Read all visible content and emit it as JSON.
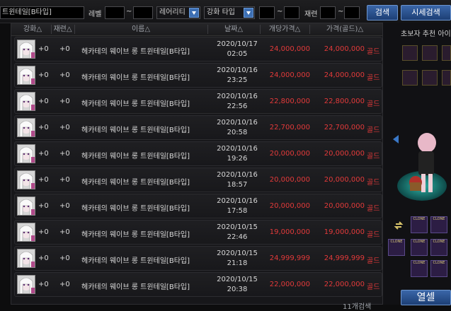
{
  "search": {
    "item_name": "트윈테일[B타입]",
    "level_label": "레벨",
    "range_sep": "~",
    "rarity_select": "레어리티",
    "reinforce_select": "강화 타입",
    "refine_label": "재련",
    "search_button": "검색",
    "market_price_button": "시세검색"
  },
  "columns": [
    "강화△",
    "재련△",
    "이름△",
    "날짜△",
    "개당가격△",
    "가격(골드)△"
  ],
  "rows": [
    {
      "reinforce": "+0",
      "refine": "+0",
      "name": "헤카테의 웨이브 롱 트윈테일[B타입]",
      "date": "2020/10/17",
      "time": "02:05",
      "unit_price": "24,000,000",
      "price": "24,000,000",
      "currency": "골드"
    },
    {
      "reinforce": "+0",
      "refine": "+0",
      "name": "헤카테의 웨이브 롱 트윈테일[B타입]",
      "date": "2020/10/16",
      "time": "23:25",
      "unit_price": "24,000,000",
      "price": "24,000,000",
      "currency": "골드"
    },
    {
      "reinforce": "+0",
      "refine": "+0",
      "name": "헤카테의 웨이브 롱 트윈테일[B타입]",
      "date": "2020/10/16",
      "time": "22:56",
      "unit_price": "22,800,000",
      "price": "22,800,000",
      "currency": "골드"
    },
    {
      "reinforce": "+0",
      "refine": "+0",
      "name": "헤카테의 웨이브 롱 트윈테일[B타입]",
      "date": "2020/10/16",
      "time": "20:58",
      "unit_price": "22,700,000",
      "price": "22,700,000",
      "currency": "골드"
    },
    {
      "reinforce": "+0",
      "refine": "+0",
      "name": "헤카테의 웨이브 롱 트윈테일[B타입]",
      "date": "2020/10/16",
      "time": "19:26",
      "unit_price": "20,000,000",
      "price": "20,000,000",
      "currency": "골드"
    },
    {
      "reinforce": "+0",
      "refine": "+0",
      "name": "헤카테의 웨이브 롱 트윈테일[B타입]",
      "date": "2020/10/16",
      "time": "18:57",
      "unit_price": "20,000,000",
      "price": "20,000,000",
      "currency": "골드"
    },
    {
      "reinforce": "+0",
      "refine": "+0",
      "name": "헤카테의 웨이브 롱 트윈테일[B타입]",
      "date": "2020/10/16",
      "time": "17:58",
      "unit_price": "20,000,000",
      "price": "20,000,000",
      "currency": "골드"
    },
    {
      "reinforce": "+0",
      "refine": "+0",
      "name": "헤카테의 웨이브 롱 트윈테일[B타입]",
      "date": "2020/10/15",
      "time": "22:46",
      "unit_price": "19,000,000",
      "price": "19,000,000",
      "currency": "골드"
    },
    {
      "reinforce": "+0",
      "refine": "+0",
      "name": "헤카테의 웨이브 롱 트윈테일[B타입]",
      "date": "2020/10/15",
      "time": "21:18",
      "unit_price": "24,999,999",
      "price": "24,999,999",
      "currency": "골드"
    },
    {
      "reinforce": "+0",
      "refine": "+0",
      "name": "헤카테의 웨이브 롱 트윈테일[B타입]",
      "date": "2020/10/15",
      "time": "20:38",
      "unit_price": "22,000,000",
      "price": "22,000,000",
      "currency": "골드"
    }
  ],
  "footer": {
    "result_count": "11개검색"
  },
  "sidepanel": {
    "title": "초보자 추천 아이",
    "slot_tag": "CLONE",
    "bottom_button": "열셀"
  },
  "colors": {
    "price_red": "#e33a3a",
    "accent_blue": "#3d6fb3"
  }
}
